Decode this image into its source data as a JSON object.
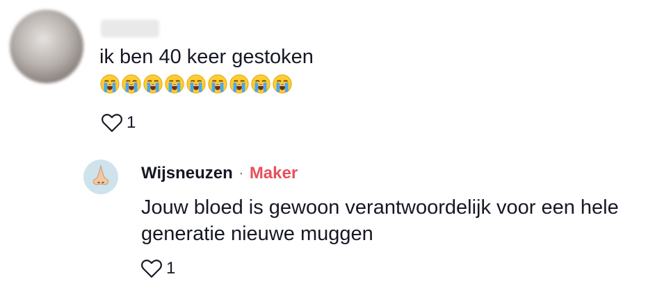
{
  "comment": {
    "username": "username",
    "text": "ik ben 40 keer gestoken",
    "emojis": [
      "loudly-crying-face",
      "loudly-crying-face",
      "loudly-crying-face",
      "loudly-crying-face",
      "loudly-crying-face",
      "loudly-crying-face",
      "loudly-crying-face",
      "loudly-crying-face",
      "loudly-crying-face"
    ],
    "likes": "1"
  },
  "reply": {
    "username": "Wijsneuzen",
    "separator": "·",
    "badge": "Maker",
    "text": "Jouw bloed is gewoon verantwoordelijk voor een hele generatie nieuwe muggen",
    "likes": "1",
    "avatar_icon": "nose-emoji"
  },
  "colors": {
    "text": "#161823",
    "maker_badge": "#e8505b",
    "avatar_bg": "#cfe3ec",
    "muted": "#8a8b91"
  }
}
